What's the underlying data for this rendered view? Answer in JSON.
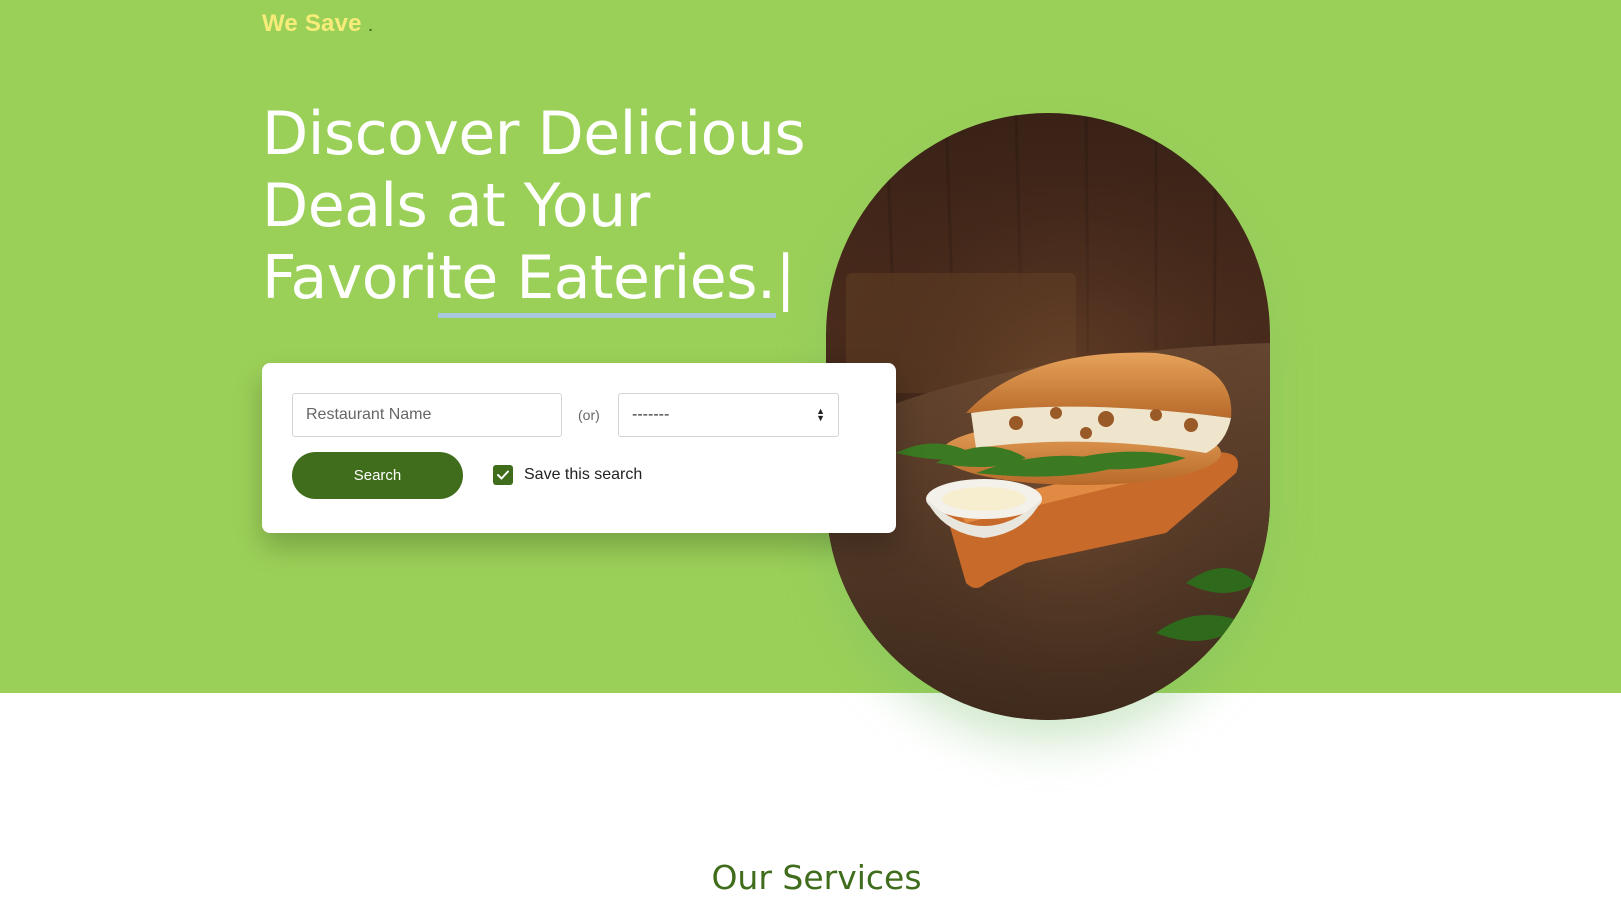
{
  "colors": {
    "hero_bg": "#9bd058",
    "brand_text": "#f7ec7a",
    "brand_dot": "#3f6d1b",
    "primary": "#3f6d1b",
    "heading_green": "#3f6d1b",
    "underline": "#a9c8df"
  },
  "header": {
    "brand": "We Save",
    "brand_dot": "."
  },
  "hero": {
    "headline_line1": "Discover Delicious",
    "headline_line2": "Deals at Your",
    "headline_line3_prefix": "Favori",
    "headline_line3_highlight": "te Eateries.",
    "caret": "|"
  },
  "search": {
    "name_placeholder": "Restaurant Name",
    "or_text": "(or)",
    "select_value": "-------",
    "button_label": "Search",
    "save_checked": true,
    "save_label": "Save this search"
  },
  "image": {
    "icon": "sandwich-photo"
  },
  "sections": {
    "services_title": "Our Services"
  }
}
